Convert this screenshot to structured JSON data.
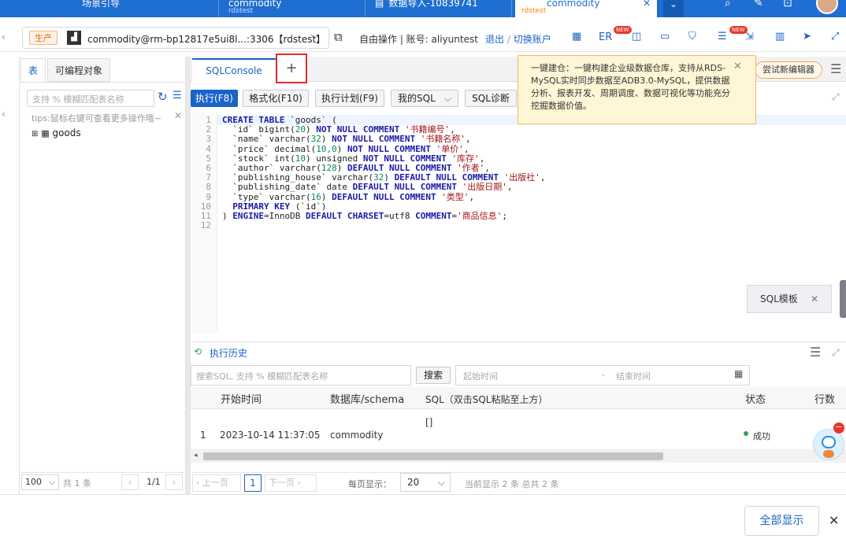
{
  "top_tabs": [
    {
      "label": "场景引导",
      "sub": ""
    },
    {
      "label": "commodity",
      "sub": "rdstest"
    },
    {
      "label": "数据导入-10839741",
      "sub": ""
    },
    {
      "label": "commodity",
      "sub": "rdstest"
    }
  ],
  "header": {
    "env_badge": "生产",
    "connection": "commodity@rm-bp12817e5ui8l...:3306【rdstest】",
    "mode_text": "自由操作 | 账号: aliyuntest",
    "logout": "退出",
    "switch_account": "切换账户",
    "er_label": "ER",
    "new_badge": "NEW"
  },
  "left_panel": {
    "tabs": [
      "表",
      "可编程对象"
    ],
    "search_placeholder": "支持 % 模糊匹配表名称",
    "tips": "tips:鼠标右键可查看更多操作哦~",
    "tree_item": "goods",
    "page_size": "100",
    "total": "共 1 条",
    "page": "1/1"
  },
  "editor": {
    "tab_label": "SQLConsole",
    "add_tab": "+",
    "toolbar": [
      "执行(F8)",
      "格式化(F10)",
      "执行计划(F9)",
      "我的SQL",
      "SQL诊断"
    ],
    "new_editor": "尝试新编辑器",
    "tooltip": "一键建仓：一键构建企业级数据仓库，支持从RDS-MySQL实时同步数据至ADB3.0-MySQL，提供数据分析、报表开发、周期调度、数据可视化等功能充分挖掘数据价值。",
    "sql_template": "SQL模板",
    "code_lines": [
      "CREATE TABLE `goods` (",
      "  `id` bigint(20) NOT NULL COMMENT '书籍编号',",
      "  `name` varchar(32) NOT NULL COMMENT '书籍名称',",
      "  `price` decimal(10,0) NOT NULL COMMENT '单价',",
      "  `stock` int(10) unsigned NOT NULL COMMENT '库存',",
      "  `author` varchar(128) DEFAULT NULL COMMENT '作者',",
      "  `publishing_house` varchar(32) DEFAULT NULL COMMENT '出版社',",
      "  `publishing_date` date DEFAULT NULL COMMENT '出版日期',",
      "  `type` varchar(16) DEFAULT NULL COMMENT '类型',",
      "  PRIMARY KEY (`id`)",
      ") ENGINE=InnoDB DEFAULT CHARSET=utf8 COMMENT='商品信息';",
      ""
    ]
  },
  "history": {
    "title": "执行历史",
    "search_placeholder": "搜索SQL, 支持 % 模糊匹配表名称",
    "search_btn": "搜索",
    "start_placeholder": "起始时间",
    "end_placeholder": "结束时间",
    "columns": [
      "开始时间",
      "数据库/schema",
      "SQL（双击SQL粘贴至上方）",
      "状态",
      "行数"
    ],
    "rows": [
      {
        "idx": "1",
        "time": "2023-10-14 11:37:05",
        "db": "commodity",
        "sql": "[]",
        "status": "成功"
      }
    ],
    "prev": "上一页",
    "next": "下一页",
    "page_num": "1",
    "per_page_label": "每页显示：",
    "per_page": "20",
    "summary": "当前显示 2 条 总共 2 条"
  },
  "footer": {
    "show_all": "全部显示"
  }
}
